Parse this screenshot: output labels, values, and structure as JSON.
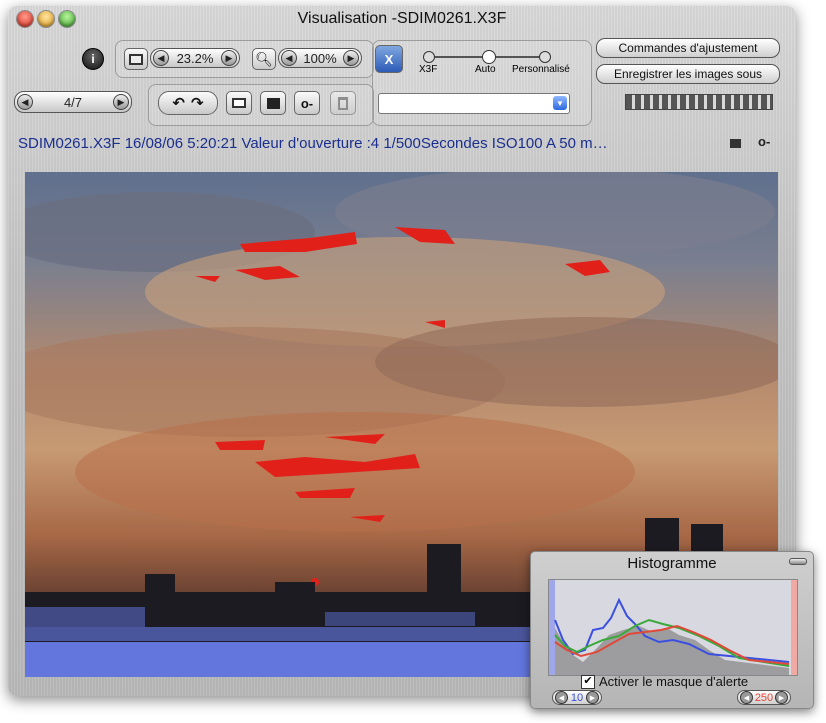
{
  "window": {
    "title": "Visualisation -SDIM0261.X3F"
  },
  "toolbar": {
    "zoom_fit_value": "23.2%",
    "zoom_value": "100%",
    "page_counter": "4/7",
    "x3f_label": "X3F",
    "auto_label": "Auto",
    "custom_label": "Personnalisé",
    "adjust_button": "Commandes d'ajustement",
    "save_button": "Enregistrer les images sous",
    "preset_select_value": ""
  },
  "info_line": "SDIM0261.X3F 16/08/06 5:20:21 Valeur d'ouverture :4 1/500Secondes ISO100 A 50 m…",
  "histogram": {
    "title": "Histogramme",
    "alert_mask_label": "Activer le masque d'alerte",
    "alert_mask_checked": true,
    "low_value": "10",
    "high_value": "250",
    "colors": {
      "red": "#e0483a",
      "green": "#3aa93a",
      "blue": "#3b4fe0"
    }
  },
  "icons": [
    "info-icon",
    "fit-icon",
    "magnify-icon",
    "x3f-mode-icon",
    "rotate-left-icon",
    "rotate-right-icon",
    "print-icon",
    "flag-icon",
    "key-icon",
    "trash-icon",
    "dropdown-arrow-icon"
  ]
}
